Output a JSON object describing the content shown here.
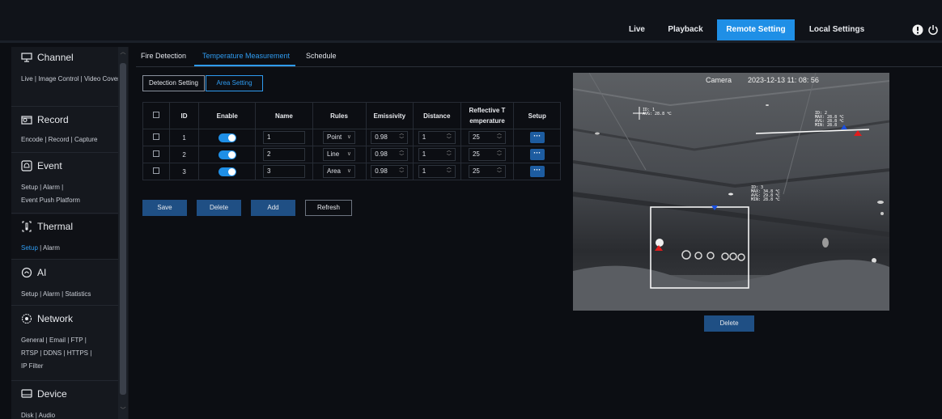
{
  "nav": {
    "live": "Live",
    "playback": "Playback",
    "remote_setting": "Remote Setting",
    "local_settings": "Local Settings"
  },
  "icons": {
    "info": "info-icon",
    "power": "power-icon"
  },
  "colors": {
    "accent": "#1f8fe6",
    "link_active": "#2f9bf0",
    "toggle_on": "#1f8fe6"
  },
  "sidebar": {
    "channel": {
      "title": "Channel",
      "links": "Live | Image Control | Video Cover"
    },
    "record": {
      "title": "Record",
      "links": "Encode | Record | Capture"
    },
    "event": {
      "title": "Event",
      "links_1": "Setup | Alarm |",
      "links_2": "Event Push Platform"
    },
    "thermal": {
      "title": "Thermal",
      "link_setup": "Setup",
      "link_rest": " | Alarm"
    },
    "ai": {
      "title": "AI",
      "links": "Setup | Alarm | Statistics"
    },
    "network": {
      "title": "Network",
      "links_1": "General | Email | FTP |",
      "links_2": "RTSP | DDNS | HTTPS |",
      "links_3": "IP Filter"
    },
    "device": {
      "title": "Device",
      "links": "Disk | Audio"
    }
  },
  "tabs": {
    "fire": "Fire Detection",
    "temp": "Temperature Measurement",
    "schedule": "Schedule"
  },
  "subtabs": {
    "detection": "Detection Setting",
    "area": "Area Setting"
  },
  "table": {
    "headers": {
      "id": "ID",
      "enable": "Enable",
      "name": "Name",
      "rules": "Rules",
      "emissivity": "Emissivity",
      "distance": "Distance",
      "reflective_1": "Reflective T",
      "reflective_2": "emperature",
      "setup": "Setup"
    },
    "rows": [
      {
        "id": "1",
        "enable": true,
        "name": "1",
        "rule": "Point",
        "emissivity": "0.98",
        "distance": "1",
        "reflective": "25",
        "setup": "···"
      },
      {
        "id": "2",
        "enable": true,
        "name": "2",
        "rule": "Line",
        "emissivity": "0.98",
        "distance": "1",
        "reflective": "25",
        "setup": "···"
      },
      {
        "id": "3",
        "enable": true,
        "name": "3",
        "rule": "Area",
        "emissivity": "0.98",
        "distance": "1",
        "reflective": "25",
        "setup": "···"
      }
    ]
  },
  "actions": {
    "save": "Save",
    "delete": "Delete",
    "add": "Add",
    "refresh": "Refresh"
  },
  "camera": {
    "label": "Camera",
    "timestamp": "2023-12-13 11: 08: 56",
    "point": {
      "id": "ID: 1",
      "avg": "AVG: 28.8 ℃"
    },
    "line": {
      "id": "ID: 2",
      "max": "MAX: 28.8 ℃",
      "avg": "AVG: 28.8 ℃",
      "min": "MIN: 28.8"
    },
    "area": {
      "id": "ID: 3",
      "max": "MAX: 34.8 ℃",
      "avg": "AVG: 29.8 ℃",
      "min": "MIN: 28.8 ℃"
    },
    "delete": "Delete"
  }
}
